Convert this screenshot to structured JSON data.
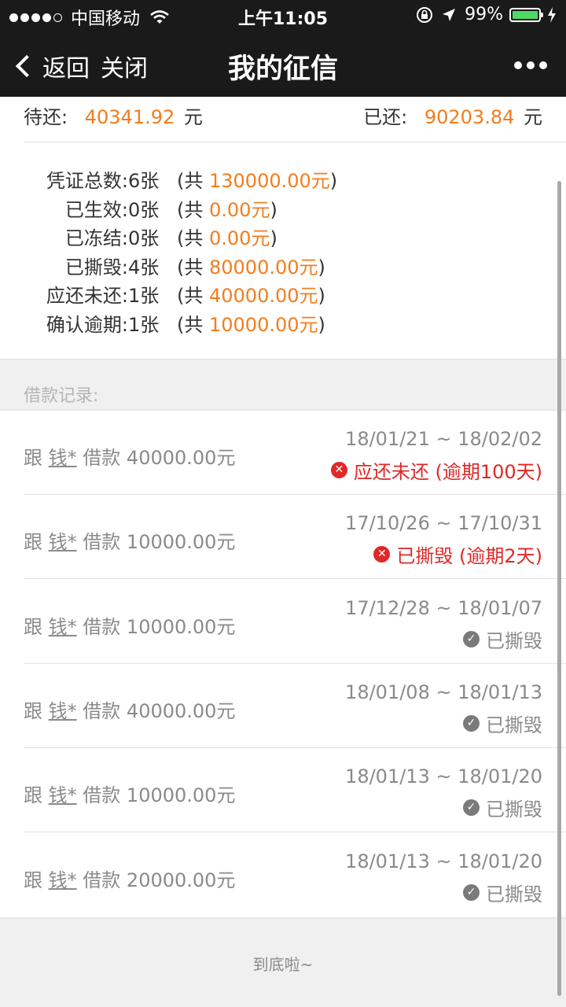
{
  "status_bar": {
    "carrier": "中国移动",
    "time": "上午11:05",
    "battery": "99%",
    "battery_level": 0.99
  },
  "nav": {
    "back_label": "返回",
    "close_label": "关闭",
    "title": "我的征信"
  },
  "summary": {
    "pending_label": "待还:",
    "pending_value": "40341.92",
    "paid_label": "已还:",
    "paid_value": "90203.84",
    "unit": "元"
  },
  "stats": [
    {
      "label": "凭证总数:",
      "count": "6张",
      "prefix": "(共 ",
      "amount": "130000.00元",
      "suffix": ")"
    },
    {
      "label": "已生效:",
      "count": "0张",
      "prefix": "(共 ",
      "amount": "0.00元",
      "suffix": ")"
    },
    {
      "label": "已冻结:",
      "count": "0张",
      "prefix": "(共 ",
      "amount": "0.00元",
      "suffix": ")"
    },
    {
      "label": "已撕毁:",
      "count": "4张",
      "prefix": "(共 ",
      "amount": "80000.00元",
      "suffix": ")"
    },
    {
      "label": "应还未还:",
      "count": "1张",
      "prefix": "(共 ",
      "amount": "40000.00元",
      "suffix": ")"
    },
    {
      "label": "确认逾期:",
      "count": "1张",
      "prefix": "(共 ",
      "amount": "10000.00元",
      "suffix": ")"
    }
  ],
  "records_header": "借款记录:",
  "records": [
    {
      "prefix": "跟",
      "name": "钱*",
      "action": "借款",
      "amount": "40000.00元",
      "dates": "18/01/21 ~ 18/02/02",
      "status": "应还未还 (逾期100天)",
      "status_type": "error"
    },
    {
      "prefix": "跟",
      "name": "钱*",
      "action": "借款",
      "amount": "10000.00元",
      "dates": "17/10/26 ~ 17/10/31",
      "status": "已撕毁 (逾期2天)",
      "status_type": "error"
    },
    {
      "prefix": "跟",
      "name": "钱*",
      "action": "借款",
      "amount": "10000.00元",
      "dates": "17/12/28 ~ 18/01/07",
      "status": "已撕毁",
      "status_type": "done"
    },
    {
      "prefix": "跟",
      "name": "钱*",
      "action": "借款",
      "amount": "40000.00元",
      "dates": "18/01/08 ~ 18/01/13",
      "status": "已撕毁",
      "status_type": "done"
    },
    {
      "prefix": "跟",
      "name": "钱*",
      "action": "借款",
      "amount": "10000.00元",
      "dates": "18/01/13 ~ 18/01/20",
      "status": "已撕毁",
      "status_type": "done"
    },
    {
      "prefix": "跟",
      "name": "钱*",
      "action": "借款",
      "amount": "20000.00元",
      "dates": "18/01/13 ~ 18/01/20",
      "status": "已撕毁",
      "status_type": "done"
    }
  ],
  "footer": "到底啦~",
  "colors": {
    "accent": "#f27d1d",
    "error": "#e02828",
    "topbar": "#1a1a1a"
  }
}
